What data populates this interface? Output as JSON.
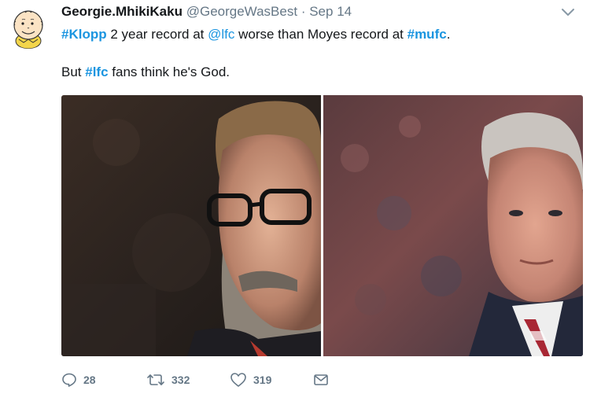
{
  "tweet": {
    "display_name": "Georgie.MhikiKaku",
    "handle": "@GeorgeWasBest",
    "separator": "·",
    "date": "Sep 14",
    "line1": {
      "tag1": "#Klopp",
      "text1": " 2 year record at ",
      "tag2": "@lfc",
      "text2": " worse than Moyes record at ",
      "tag3": "#mufc",
      "text3": "."
    },
    "line2": {
      "text1": "But ",
      "tag1": "#lfc",
      "text2": " fans think he's God."
    },
    "icons": {
      "avatar": "charlie-brown-avatar",
      "caret": "chevron-down-icon",
      "reply": "reply-icon",
      "retweet": "retweet-icon",
      "like": "heart-icon",
      "message": "envelope-icon"
    },
    "media": {
      "left_photo": "man-with-glasses-photo",
      "right_photo": "grey-haired-man-photo"
    }
  },
  "actions": {
    "reply_count": "28",
    "retweet_count": "332",
    "like_count": "319"
  },
  "colors": {
    "link": "#1b95e0",
    "text": "#14171a",
    "muted": "#657786"
  }
}
